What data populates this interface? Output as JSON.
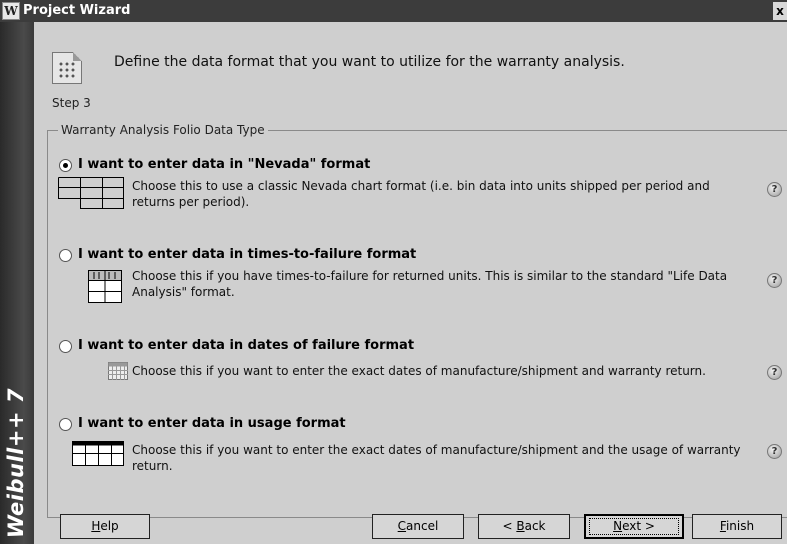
{
  "window": {
    "title": "Project Wizard",
    "app_icon": "W",
    "close_glyph": "x"
  },
  "brand": {
    "text": "Weibull++ 7"
  },
  "header": {
    "description": "Define the data format that you want to utilize for the warranty analysis.",
    "step": "Step 3"
  },
  "group": {
    "legend": "Warranty Analysis Folio Data Type"
  },
  "options": [
    {
      "title": "I want to enter data in \"Nevada\" format",
      "description": "Choose this to use a classic Nevada chart format (i.e. bin data into units shipped per period and returns per period).",
      "selected": true,
      "icon": "nevada-chart-icon"
    },
    {
      "title": "I want to enter data in times-to-failure format",
      "description": "Choose this if you have times-to-failure for returned units. This is similar to the standard \"Life Data Analysis\" format.",
      "selected": false,
      "icon": "times-to-failure-grid-icon"
    },
    {
      "title": "I want to enter data in dates of failure format",
      "description": "Choose this if you want to enter the exact dates of manufacture/shipment and warranty return.",
      "selected": false,
      "icon": "calendar-icon"
    },
    {
      "title": "I want to enter data in usage format",
      "description": "Choose this if you want to enter the exact dates of manufacture/shipment and the usage of warranty return.",
      "selected": false,
      "icon": "usage-grid-icon"
    }
  ],
  "help_glyph": "?",
  "buttons": {
    "help": {
      "mnemonic": "H",
      "rest": "elp"
    },
    "cancel": {
      "mnemonic": "C",
      "rest": "ancel"
    },
    "back": {
      "pre": "< ",
      "mnemonic": "B",
      "rest": "ack"
    },
    "next": {
      "mnemonic": "N",
      "rest": "ext >"
    },
    "finish": {
      "mnemonic": "F",
      "rest": "inish"
    }
  }
}
